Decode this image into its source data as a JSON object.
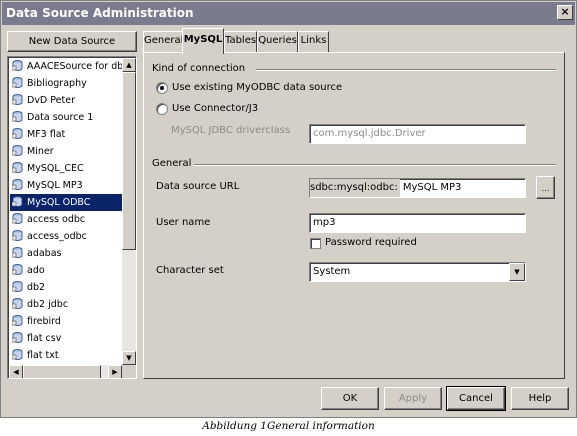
{
  "window": {
    "title": "Data Source Administration",
    "close": "×"
  },
  "sidebar": {
    "new_button": "New Data Source",
    "items": [
      {
        "label": "AAACESource for dbu-"
      },
      {
        "label": "Bibliography"
      },
      {
        "label": "DvD Peter"
      },
      {
        "label": "Data source 1"
      },
      {
        "label": "MF3 flat"
      },
      {
        "label": "Miner"
      },
      {
        "label": "MySQL_CEC"
      },
      {
        "label": "MySQL MP3"
      },
      {
        "label": "MySQL ODBC",
        "selected": true
      },
      {
        "label": "access odbc"
      },
      {
        "label": "access_odbc"
      },
      {
        "label": "adabas"
      },
      {
        "label": "ado"
      },
      {
        "label": "db2"
      },
      {
        "label": "db2 jdbc"
      },
      {
        "label": "firebird"
      },
      {
        "label": "flat csv"
      },
      {
        "label": "flat txt"
      }
    ]
  },
  "tabs": [
    "General",
    "MySQL",
    "Tables",
    "Queries",
    "Links"
  ],
  "connection": {
    "group_label": "Kind of connection",
    "option_odbc": "Use existing MyODBC data source",
    "option_jdbc": "Use Connector/J3",
    "driverclass_label": "MySQL JDBC driverclass",
    "driverclass_value": "com.mysql.jdbc.Driver"
  },
  "general": {
    "group_label": "General",
    "url_label": "Data source URL",
    "url_prefix": "sdbc:mysql:odbc:",
    "url_value": "MySQL MP3",
    "browse_label": "...",
    "username_label": "User name",
    "username_value": "mp3",
    "password_label": "Password required",
    "charset_label": "Character set",
    "charset_value": "System"
  },
  "buttons": {
    "ok": "OK",
    "apply": "Apply",
    "cancel": "Cancel",
    "help": "Help"
  },
  "caption": "Abbildung 1General information",
  "colors": {
    "titlebar": "#7b7b8e",
    "selection": "#0a246a",
    "dialog_bg": "#d4d0c8"
  }
}
